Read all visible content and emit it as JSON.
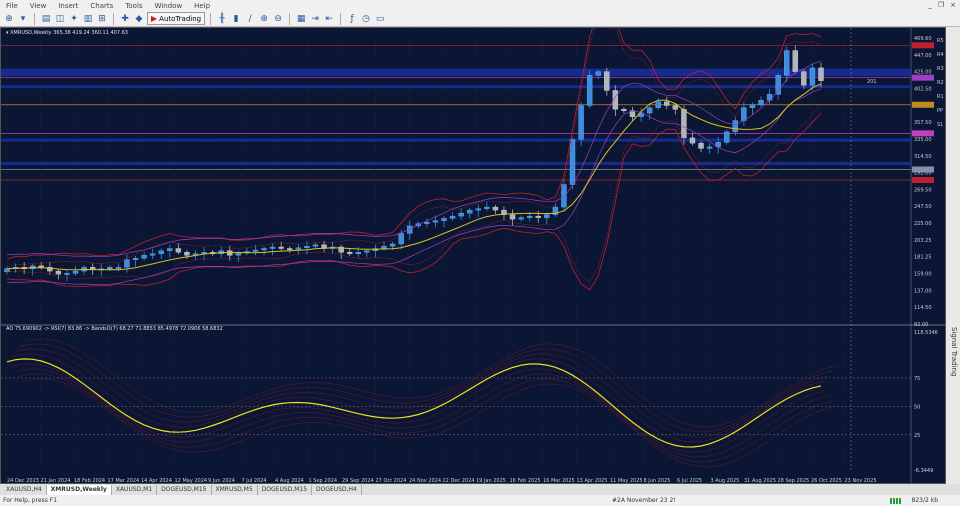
{
  "menubar": {
    "items": [
      "File",
      "View",
      "Insert",
      "Charts",
      "Tools",
      "Window",
      "Help"
    ]
  },
  "toolbar": {
    "autotrading_label": "AutoTrading"
  },
  "chart": {
    "header": "XMRUSD,Weekly 365.38 419.24 360.11 407.63",
    "indicator_header": "AO 75.690902 -> RSI(7) 83.86 -> BandsO(7) 68.27 71.8853 85.4978 72.0906 58.6832",
    "price_labels": [
      "469.60",
      "447.00",
      "425.00",
      "402.50",
      "380.00",
      "357.50",
      "335.00",
      "314.50",
      "292.00",
      "269.50",
      "247.50",
      "225.00",
      "203.25",
      "181.25",
      "159.00",
      "137.00",
      "114.50",
      "92.00"
    ],
    "level_tags": [
      "R5",
      "R4",
      "R3",
      "R2",
      "R1",
      "PP",
      "S1"
    ],
    "ind_labels": [
      "118.5346",
      "75",
      "50",
      "25",
      "-6.3449"
    ],
    "marker_label": "201",
    "date_labels": [
      "24 Dec 2023",
      "21 Jan 2024",
      "18 Feb 2024",
      "17 Mar 2024",
      "14 Apr 2024",
      "12 May 2024",
      "9 Jun 2024",
      "7 Jul 2024",
      "4 Aug 2024",
      "1 Sep 2024",
      "29 Sep 2024",
      "27 Oct 2024",
      "24 Nov 2024",
      "22 Dec 2024",
      "19 Jan 2025",
      "16 Feb 2025",
      "16 Mar 2025",
      "13 Apr 2025",
      "11 May 2025",
      "8 Jun 2025",
      "6 Jul 2025",
      "3 Aug 2025",
      "31 Aug 2025",
      "28 Sep 2025",
      "26 Oct 2025",
      "23 Nov 2025"
    ],
    "colors": {
      "bg": "#0a1633",
      "bull": "#3a8ee0",
      "bear": "#b0b4bc",
      "ma": "#e0c020",
      "band_outer": "#c02030",
      "band_mid": "#a040c0",
      "rsi": "#f0e020"
    }
  },
  "tabs": [
    "XAUUSD,H4",
    "XMRUSD,Weekly",
    "XAUUSD,M1",
    "DOGEUSD,M15",
    "XMRUSD,M5",
    "DOGEUSD,M15",
    "DOGEUSD,H4"
  ],
  "status": {
    "help": "For Help, press F1",
    "time": "#2A November 23 2!",
    "traffic": "823/2 kb"
  },
  "side_label": "Signal Trading",
  "chart_data": {
    "type": "candlestick",
    "close": [
      158,
      160,
      158,
      162,
      160,
      155,
      151,
      152,
      155,
      160,
      157,
      158,
      160,
      160,
      170,
      172,
      176,
      178,
      182,
      185,
      180,
      176,
      178,
      180,
      178,
      182,
      176,
      179,
      181,
      183,
      185,
      187,
      185,
      184,
      186,
      188,
      190,
      185,
      187,
      180,
      178,
      180,
      182,
      185,
      188,
      191,
      205,
      215,
      218,
      220,
      222,
      225,
      228,
      232,
      236,
      238,
      240,
      236,
      230,
      224,
      226,
      228,
      226,
      230,
      240,
      270,
      330,
      375,
      415,
      420,
      395,
      370,
      368,
      360,
      365,
      372,
      380,
      375,
      370,
      332,
      325,
      318,
      320,
      326,
      340,
      355,
      372,
      376,
      382,
      390,
      415,
      448,
      420,
      402,
      425,
      408
    ]
  }
}
